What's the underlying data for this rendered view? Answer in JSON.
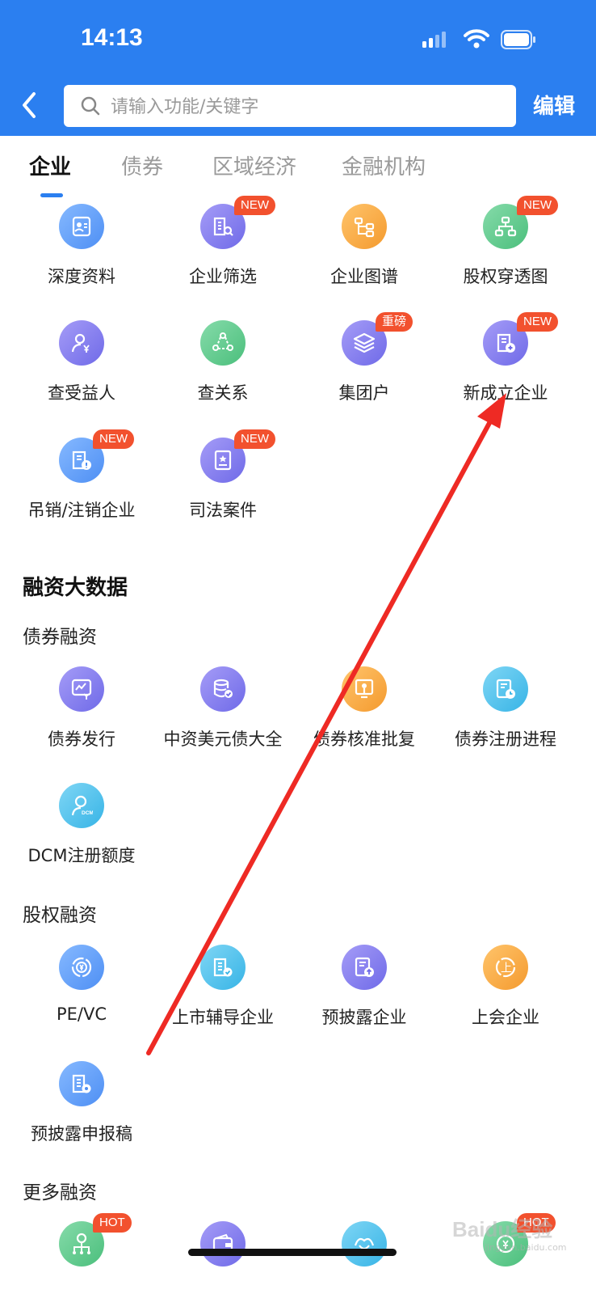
{
  "status_bar": {
    "time": "14:13"
  },
  "search": {
    "placeholder": "请输入功能/关键字",
    "value": ""
  },
  "header": {
    "edit_label": "编辑"
  },
  "tabs": [
    {
      "label": "企业",
      "active": true
    },
    {
      "label": "债券",
      "active": false
    },
    {
      "label": "区域经济",
      "active": false
    },
    {
      "label": "金融机构",
      "active": false
    }
  ],
  "enterprise_items": [
    {
      "label": "深度资料",
      "icon": "id-card-icon",
      "color": "blue"
    },
    {
      "label": "企业筛选",
      "icon": "building-search-icon",
      "color": "purple",
      "badge": "NEW"
    },
    {
      "label": "企业图谱",
      "icon": "graph-tree-icon",
      "color": "orange"
    },
    {
      "label": "股权穿透图",
      "icon": "org-chart-icon",
      "color": "green",
      "badge": "NEW"
    },
    {
      "label": "查受益人",
      "icon": "person-yen-icon",
      "color": "purple"
    },
    {
      "label": "查关系",
      "icon": "relation-network-icon",
      "color": "green"
    },
    {
      "label": "集团户",
      "icon": "layers-icon",
      "color": "purple",
      "badge": "重磅"
    },
    {
      "label": "新成立企业",
      "icon": "new-building-icon",
      "color": "purple",
      "badge": "NEW"
    },
    {
      "label": "吊销/注销企业",
      "icon": "revoked-building-icon",
      "color": "blue",
      "badge": "NEW"
    },
    {
      "label": "司法案件",
      "icon": "legal-case-icon",
      "color": "purple",
      "badge": "NEW"
    }
  ],
  "financing": {
    "title": "融资大数据",
    "bond_financing": {
      "title": "债券融资",
      "items": [
        {
          "label": "债券发行",
          "icon": "bond-issue-icon",
          "color": "purple"
        },
        {
          "label": "中资美元债大全",
          "icon": "database-check-icon",
          "color": "purple"
        },
        {
          "label": "债券核准批复",
          "icon": "approval-doc-icon",
          "color": "orange"
        },
        {
          "label": "债券注册进程",
          "icon": "register-progress-icon",
          "color": "cyan"
        },
        {
          "label": "DCM注册额度",
          "icon": "dcm-person-icon",
          "color": "cyan"
        }
      ]
    },
    "equity_financing": {
      "title": "股权融资",
      "items": [
        {
          "label": "PE/VC",
          "icon": "pe-vc-coin-icon",
          "color": "blue"
        },
        {
          "label": "上市辅导企业",
          "icon": "listing-guidance-icon",
          "color": "cyan"
        },
        {
          "label": "预披露企业",
          "icon": "pre-disclosure-icon",
          "color": "purple"
        },
        {
          "label": "上会企业",
          "icon": "meeting-company-icon",
          "color": "orange"
        },
        {
          "label": "预披露申报稿",
          "icon": "pre-disclosure-draft-icon",
          "color": "blue"
        }
      ]
    },
    "more_financing": {
      "title": "更多融资",
      "items": [
        {
          "label": "",
          "icon": "funding-tree-icon",
          "color": "green",
          "badge": "HOT"
        },
        {
          "label": "",
          "icon": "wallet-icon",
          "color": "purple"
        },
        {
          "label": "",
          "icon": "handshake-icon",
          "color": "cyan"
        },
        {
          "label": "",
          "icon": "finance-icon",
          "color": "green",
          "badge": "HOT"
        }
      ]
    }
  },
  "watermark": {
    "text": "Baidu经验",
    "sub": "jingyan.baidu.com"
  },
  "colors": {
    "header_blue": "#2b7ff0",
    "badge_red": "#f2512e",
    "arrow_red": "#ee2a24"
  }
}
